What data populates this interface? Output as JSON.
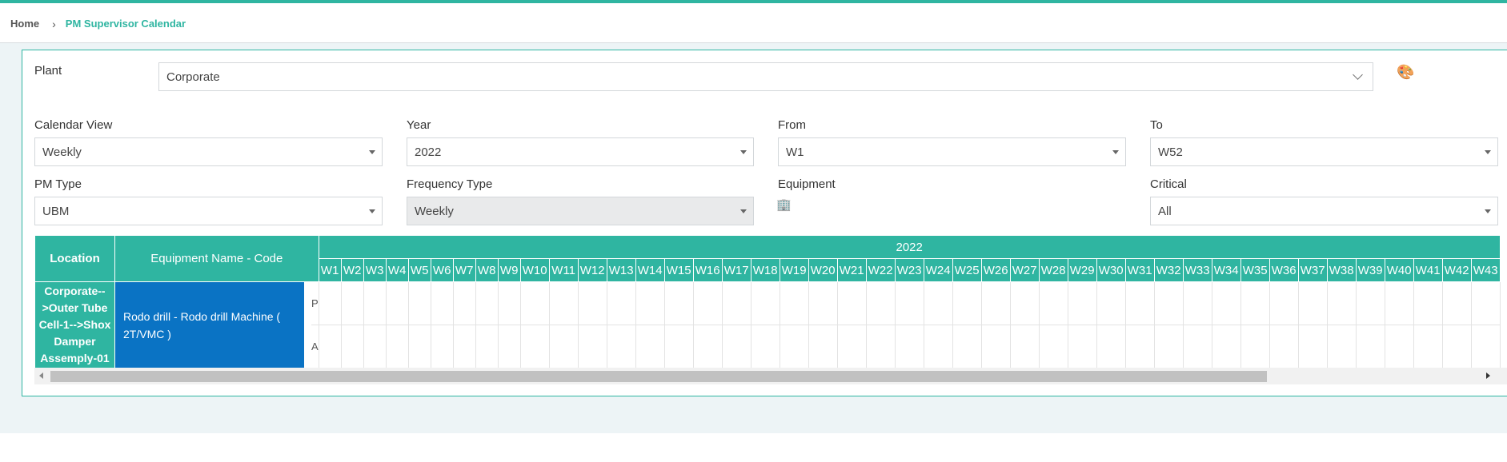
{
  "breadcrumb": {
    "home": "Home",
    "separator": "›",
    "current": "PM Supervisor Calendar"
  },
  "filters": {
    "plant": {
      "label": "Plant",
      "value": "Corporate"
    },
    "calendar_view": {
      "label": "Calendar View",
      "value": "Weekly"
    },
    "year": {
      "label": "Year",
      "value": "2022"
    },
    "from": {
      "label": "From",
      "value": "W1"
    },
    "to": {
      "label": "To",
      "value": "W52"
    },
    "pm_type": {
      "label": "PM Type",
      "value": "UBM"
    },
    "frequency_type": {
      "label": "Frequency Type",
      "value": "Weekly"
    },
    "equipment": {
      "label": "Equipment"
    },
    "critical": {
      "label": "Critical",
      "value": "All"
    }
  },
  "icons": {
    "palette": "palette-icon",
    "equipment": "building-icon"
  },
  "colors": {
    "accent": "#2fb5a1",
    "equipment_cell": "#0a73c4"
  },
  "grid": {
    "headers": {
      "location": "Location",
      "equipment": "Equipment Name - Code",
      "year": "2022"
    },
    "weeks": [
      "W1",
      "W2",
      "W3",
      "W4",
      "W5",
      "W6",
      "W7",
      "W8",
      "W9",
      "W10",
      "W11",
      "W12",
      "W13",
      "W14",
      "W15",
      "W16",
      "W17",
      "W18",
      "W19",
      "W20",
      "W21",
      "W22",
      "W23",
      "W24",
      "W25",
      "W26",
      "W27",
      "W28",
      "W29",
      "W30",
      "W31",
      "W32",
      "W33",
      "W34",
      "W35",
      "W36",
      "W37",
      "W38",
      "W39",
      "W40",
      "W41",
      "W42",
      "W43"
    ],
    "rows": [
      {
        "location": "Corporate-->Outer Tube Cell-1-->Shox Damper Assemply-01",
        "equipment": "Rodo drill - Rodo drill Machine ( 2T/VMC )",
        "types": [
          "P",
          "A"
        ]
      }
    ]
  }
}
